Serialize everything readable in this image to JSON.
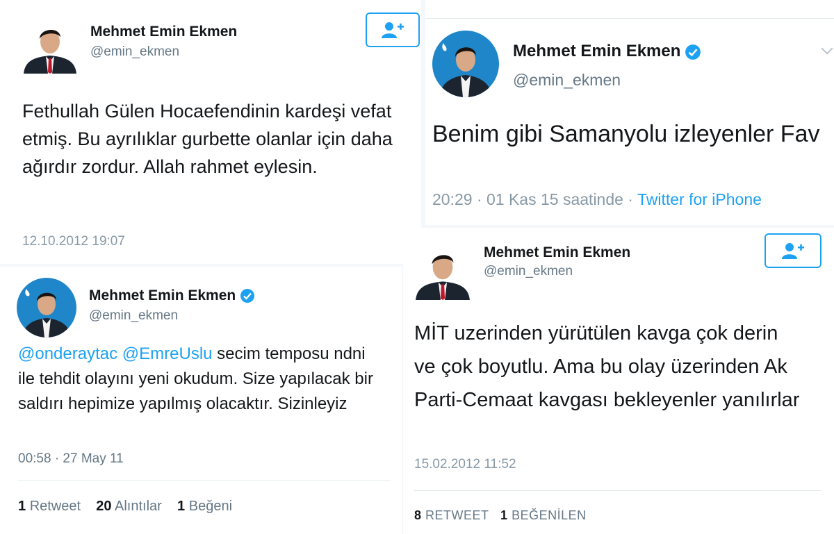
{
  "colors": {
    "accent": "#1da1f2",
    "verified": "#1da1f2",
    "muted": "#8899a6",
    "text": "#14171a"
  },
  "tweet1": {
    "name": "Mehmet Emin Ekmen",
    "handle": "@emin_ekmen",
    "text": "Fethullah Gülen Hocaefendinin kardeşi vefat etmiş. Bu ayrılıklar gurbette olanlar için  daha ağırdır zordur. Allah rahmet eylesin.",
    "timestamp": "12.10.2012 19:07",
    "follow_icon": "add-user-icon"
  },
  "tweet2": {
    "name": "Mehmet Emin Ekmen",
    "handle": "@emin_ekmen",
    "verified_icon": "verified-badge-icon",
    "mention1": "@onderaytac",
    "mention2": "@EmreUslu",
    "text": "secim temposu ndni ile tehdit olayını yeni okudum. Size yapılacak bir saldırı hepimize yapılmış olacaktır. Sizinleyiz",
    "timestamp": "00:58 · 27 May 11",
    "retweets_count": "1",
    "retweets_label": "Retweet",
    "quotes_count": "20",
    "quotes_label": "Alıntılar",
    "likes_count": "1",
    "likes_label": "Beğeni"
  },
  "tweet3": {
    "name": "Mehmet Emin Ekmen",
    "handle": "@emin_ekmen",
    "verified_icon": "verified-badge-icon",
    "text": "Benim gibi Samanyolu izleyenler Fav",
    "timestamp": "20:29 · 01 Kas 15 saatinde · ",
    "source": "Twitter for iPhone",
    "menu_icon": "chevron-down-icon"
  },
  "tweet4": {
    "name": "Mehmet Emin Ekmen",
    "handle": "@emin_ekmen",
    "text": "MİT uzerinden yürütülen kavga çok derin ve çok boyutlu. Ama bu olay üzerinden Ak Parti-Cemaat kavgası bekleyenler yanılırlar",
    "timestamp": "15.02.2012 11:52",
    "retweets_count": "8",
    "retweets_label": "RETWEET",
    "likes_count": "1",
    "likes_label": "BEĞENİLEN",
    "follow_icon": "add-user-icon"
  }
}
